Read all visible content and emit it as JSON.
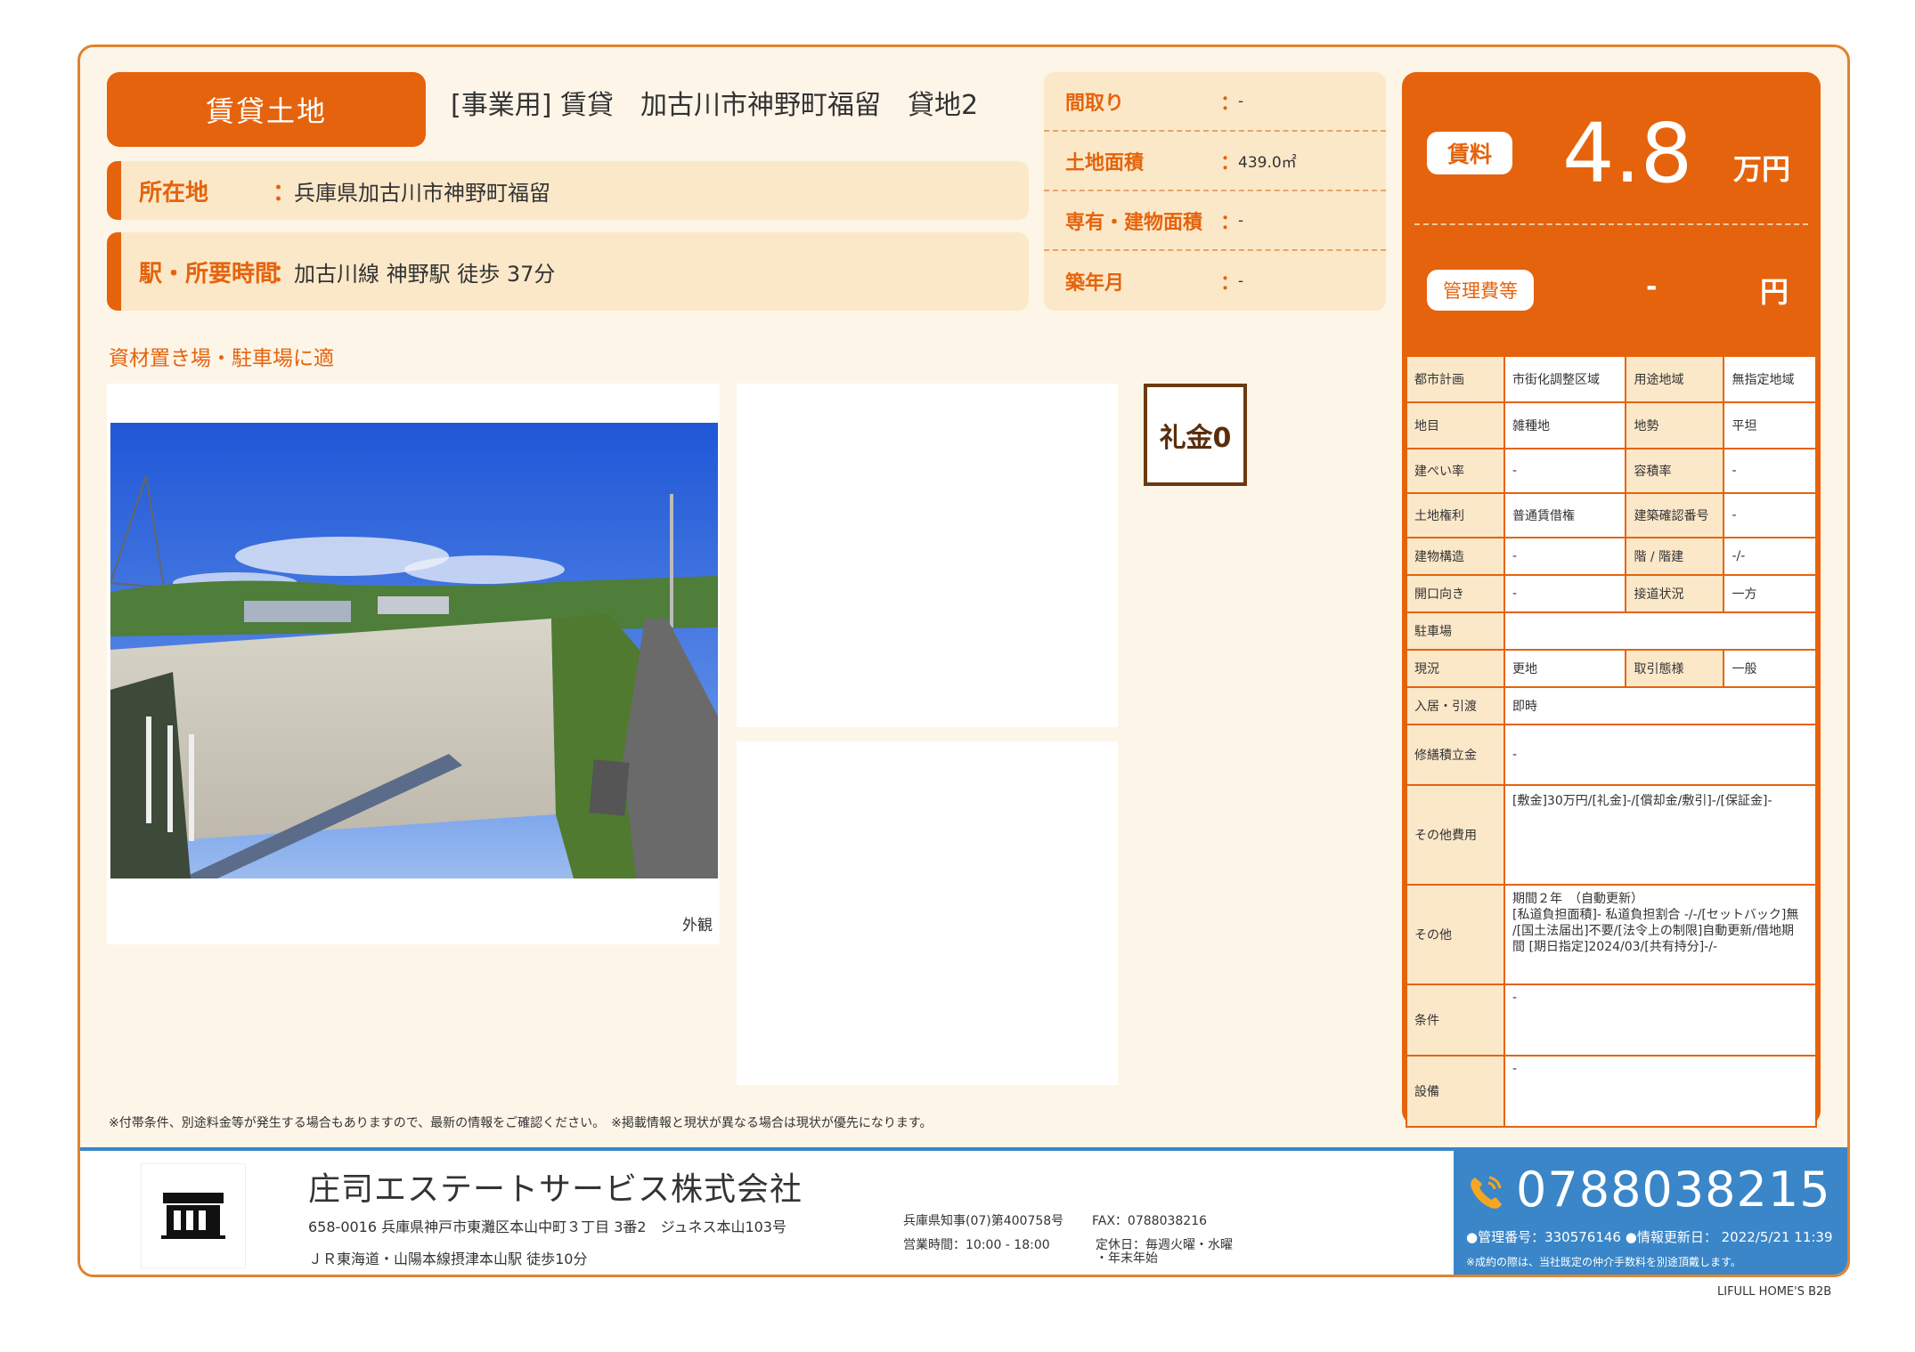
{
  "header": {
    "type_label": "賃貸土地",
    "title": "[事業用] 賃貸　加古川市神野町福留　貸地2"
  },
  "location": {
    "label": "所在地",
    "colon": "：",
    "value": "兵庫県加古川市神野町福留"
  },
  "station": {
    "label": "駅・所要時間",
    "colon": "：",
    "value": "加古川線 神野駅 徒歩 37分"
  },
  "specs": [
    {
      "label": "間取り",
      "colon": "：",
      "value": "-"
    },
    {
      "label": "土地面積",
      "colon": "：",
      "value": "439.0㎡"
    },
    {
      "label": "専有・建物面積",
      "colon": "：",
      "value": "-"
    },
    {
      "label": "築年月",
      "colon": "：",
      "value": "-"
    }
  ],
  "catch_copy": "資材置き場・駐車場に適",
  "photo": {
    "caption": "外観"
  },
  "reikin": "礼金0",
  "rent": {
    "label": "賃料",
    "value": "4.8",
    "unit": "万円",
    "fee_label": "管理費等",
    "fee_value": "-",
    "fee_unit": "円"
  },
  "details": {
    "toshi": {
      "label": "都市計画",
      "value": "市街化調整区域"
    },
    "youto": {
      "label": "用途地域",
      "value": "無指定地域"
    },
    "chimoku": {
      "label": "地目",
      "value": "雑種地"
    },
    "chisei": {
      "label": "地勢",
      "value": "平坦"
    },
    "kenpei": {
      "label": "建ぺい率",
      "value": "-"
    },
    "youseki": {
      "label": "容積率",
      "value": "-"
    },
    "kenri": {
      "label": "土地権利",
      "value": "普通賃借権"
    },
    "kakunin": {
      "label": "建築確認番号",
      "value": "-"
    },
    "kouzou": {
      "label": "建物構造",
      "value": "-"
    },
    "kai": {
      "label": "階 / 階建",
      "value": "-/-"
    },
    "kaikou": {
      "label": "開口向き",
      "value": "-"
    },
    "setsudou": {
      "label": "接道状況",
      "value": "一方"
    },
    "parking": {
      "label": "駐車場",
      "value": ""
    },
    "genkyo": {
      "label": "現況",
      "value": "更地"
    },
    "torihiki": {
      "label": "取引態様",
      "value": "一般"
    },
    "nyukyo": {
      "label": "入居・引渡",
      "value": "即時"
    },
    "shuzen": {
      "label": "修繕積立金",
      "value": "-"
    },
    "other_cost": {
      "label": "その他費用",
      "value": "[敷金]30万円/[礼金]-/[償却金/敷引]-/[保証金]-"
    },
    "other": {
      "label": "その他",
      "line1": "期間２年　（自動更新）",
      "line2": "[私道負担面積]- 私道負担割合 -/-/[セットバック]無",
      "line3": "/[国土法届出]不要/[法令上の制限]自動更新/借地期",
      "line4": "間 [期日指定]2024/03/[共有持分]-/-"
    },
    "jouken": {
      "label": "条件",
      "value": "-"
    },
    "setsubi": {
      "label": "設備",
      "value": "-"
    }
  },
  "note": "※付帯条件、別途料金等が発生する場合もありますので、最新の情報をご確認ください。　※掲載情報と現状が異なる場合は現状が優先になります。",
  "footer": {
    "company": "庄司エステートサービス株式会社",
    "address": "658-0016 兵庫県神戸市東灘区本山中町３丁目 3番2　ジュネス本山103号",
    "access": "ＪＲ東海道・山陽本線摂津本山駅 徒歩10分",
    "license": "兵庫県知事(07)第400758号",
    "fax": "FAX：0788038216",
    "hours": "営業時間：10:00 - 18:00",
    "holiday_line1": "定休日：毎週火曜・水曜",
    "holiday_line2": "・年末年始",
    "tel": "0788038215",
    "meta": "●管理番号：330576146 ●情報更新日： 2022/5/21 11:39",
    "tel_note": "※成約の際は、当社既定の仲介手数料を別途頂戴します。"
  },
  "brand": "LIFULL HOME'S B2B",
  "colors": {
    "accent": "#e5630c",
    "panel": "#fbe8c9",
    "footer_blue": "#3a86c8"
  }
}
